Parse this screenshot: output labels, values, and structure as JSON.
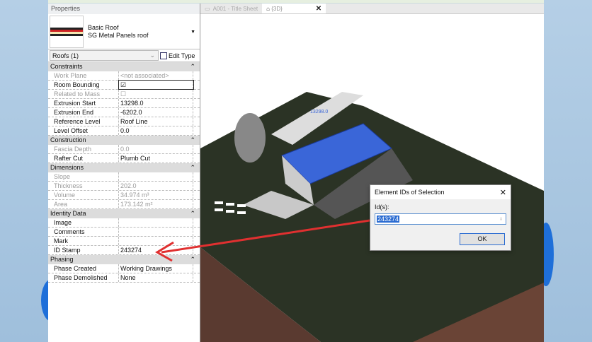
{
  "properties": {
    "title": "Properties",
    "type_family": "Basic Roof",
    "type_name": "SG Metal Panels roof",
    "instance_selector": "Roofs (1)",
    "edit_type": "Edit Type",
    "groups": [
      {
        "name": "Constraints",
        "rows": [
          {
            "k": "Work Plane",
            "v": "<not associated>",
            "dim": true
          },
          {
            "k": "Room Bounding",
            "v": "☑",
            "dim": false
          },
          {
            "k": "Related to Mass",
            "v": "☐",
            "dim": true
          },
          {
            "k": "Extrusion Start",
            "v": "13298.0",
            "dim": false
          },
          {
            "k": "Extrusion End",
            "v": "-6202.0",
            "dim": false
          },
          {
            "k": "Reference Level",
            "v": "Roof Line",
            "dim": false
          },
          {
            "k": "Level Offset",
            "v": "0.0",
            "dim": false
          }
        ]
      },
      {
        "name": "Construction",
        "rows": [
          {
            "k": "Fascia Depth",
            "v": "0.0",
            "dim": true
          },
          {
            "k": "Rafter Cut",
            "v": "Plumb Cut",
            "dim": false
          }
        ]
      },
      {
        "name": "Dimensions",
        "rows": [
          {
            "k": "Slope",
            "v": "",
            "dim": true
          },
          {
            "k": "Thickness",
            "v": "202.0",
            "dim": true
          },
          {
            "k": "Volume",
            "v": "34.974 m³",
            "dim": true
          },
          {
            "k": "Area",
            "v": "173.142 m²",
            "dim": true
          }
        ]
      },
      {
        "name": "Identity Data",
        "rows": [
          {
            "k": "Image",
            "v": "",
            "dim": false
          },
          {
            "k": "Comments",
            "v": "",
            "dim": false
          },
          {
            "k": "Mark",
            "v": "",
            "dim": false
          },
          {
            "k": "ID Stamp",
            "v": "243274",
            "dim": false
          }
        ]
      },
      {
        "name": "Phasing",
        "rows": [
          {
            "k": "Phase Created",
            "v": "Working Drawings",
            "dim": false
          },
          {
            "k": "Phase Demolished",
            "v": "None",
            "dim": false
          }
        ]
      }
    ]
  },
  "view": {
    "tabs": [
      {
        "label": "A001 - Title Sheet"
      },
      {
        "label": "{3D}"
      }
    ],
    "dim_label": "13298.0"
  },
  "dialog": {
    "title": "Element IDs of Selection",
    "label": "Id(s):",
    "value": "243274",
    "ok": "OK"
  },
  "colors": {
    "arrow": "#e03030",
    "terrain": "#2b3325",
    "selection": "#3a66d8"
  }
}
